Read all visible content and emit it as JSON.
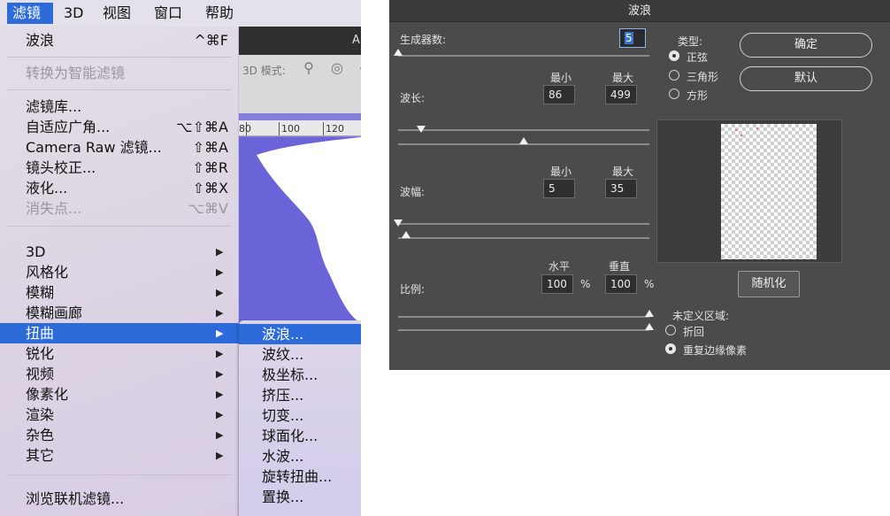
{
  "menubar": {
    "items": [
      {
        "label": "滤镜",
        "active": true
      },
      {
        "label": "3D"
      },
      {
        "label": "视图"
      },
      {
        "label": "窗口"
      },
      {
        "label": "帮助"
      }
    ]
  },
  "photoshop": {
    "tab_label": "A",
    "mode_label": "3D 模式:",
    "ruler": [
      "80",
      "100",
      "120"
    ],
    "canvas_color": "#6b64d8"
  },
  "filter_menu": {
    "last_filter": {
      "label": "波浪",
      "shortcut": "^⌘F"
    },
    "convert_smart": {
      "label": "转换为智能滤镜"
    },
    "gallery": {
      "label": "滤镜库..."
    },
    "adaptive_wide": {
      "label": "自适应广角...",
      "shortcut": "⌥⇧⌘A"
    },
    "camera_raw": {
      "label": "Camera Raw 滤镜...",
      "shortcut": "⇧⌘A"
    },
    "lens_correction": {
      "label": "镜头校正...",
      "shortcut": "⇧⌘R"
    },
    "liquify": {
      "label": "液化...",
      "shortcut": "⇧⌘X"
    },
    "vanishing_point": {
      "label": "消失点...",
      "shortcut": "⌥⌘V"
    },
    "groups": [
      "3D",
      "风格化",
      "模糊",
      "模糊画廊",
      "扭曲",
      "锐化",
      "视频",
      "像素化",
      "渲染",
      "杂色",
      "其它"
    ],
    "browse_online": {
      "label": "浏览联机滤镜..."
    },
    "arrow": "▶"
  },
  "distort_submenu": {
    "items": [
      "波浪...",
      "波纹...",
      "极坐标...",
      "挤压...",
      "切变...",
      "球面化...",
      "水波...",
      "旋转扭曲...",
      "置换..."
    ]
  },
  "wave_dialog": {
    "title": "波浪",
    "generators_label": "生成器数:",
    "generators_value": "5",
    "min_label": "最小",
    "max_label": "最大",
    "wavelength_label": "波长:",
    "wavelength_min": "86",
    "wavelength_max": "499",
    "amplitude_label": "波幅:",
    "amplitude_min": "5",
    "amplitude_max": "35",
    "scale_label": "比例:",
    "horizontal_label": "水平",
    "vertical_label": "垂直",
    "scale_h": "100",
    "scale_v": "100",
    "percent": "%",
    "type_label": "类型:",
    "type_options": [
      "正弦",
      "三角形",
      "方形"
    ],
    "type_selected": "正弦",
    "ok_button": "确定",
    "default_button": "默认",
    "randomize_button": "随机化",
    "undefined_area_label": "未定义区域:",
    "undefined_options": [
      "折回",
      "重复边缘像素"
    ],
    "undefined_selected": "重复边缘像素",
    "sliders": {
      "generators": 0.0,
      "wavelength_min": 0.09,
      "wavelength_max": 0.5,
      "amplitude_min": 0.0,
      "amplitude_max": 0.03,
      "scale_h": 1.0,
      "scale_v": 1.0
    }
  }
}
